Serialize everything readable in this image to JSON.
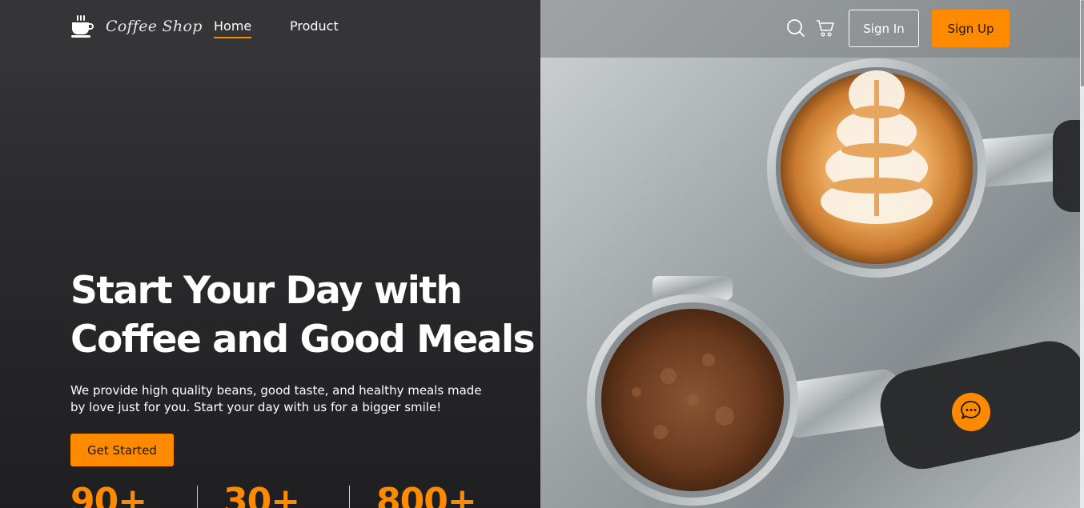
{
  "brand": {
    "name": "Coffee Shop",
    "accent": "#ff8a00"
  },
  "nav": {
    "items": [
      {
        "label": "Home",
        "active": true
      },
      {
        "label": "Product",
        "active": false
      }
    ]
  },
  "header_actions": {
    "search_icon": "search-icon",
    "cart_icon": "cart-icon",
    "sign_in": "Sign In",
    "sign_up": "Sign Up"
  },
  "hero": {
    "title_line1": "Start Your Day with",
    "title_line2": "Coffee and Good Meals",
    "description_line1": "We provide high quality beans, good taste, and healthy meals made",
    "description_line2": "by love just for you. Start your day with us for a bigger smile!",
    "cta": "Get Started"
  },
  "stats": [
    {
      "value": "90+"
    },
    {
      "value": "30+"
    },
    {
      "value": "800+"
    }
  ],
  "chat": {
    "icon": "chat-bubble-icon"
  }
}
